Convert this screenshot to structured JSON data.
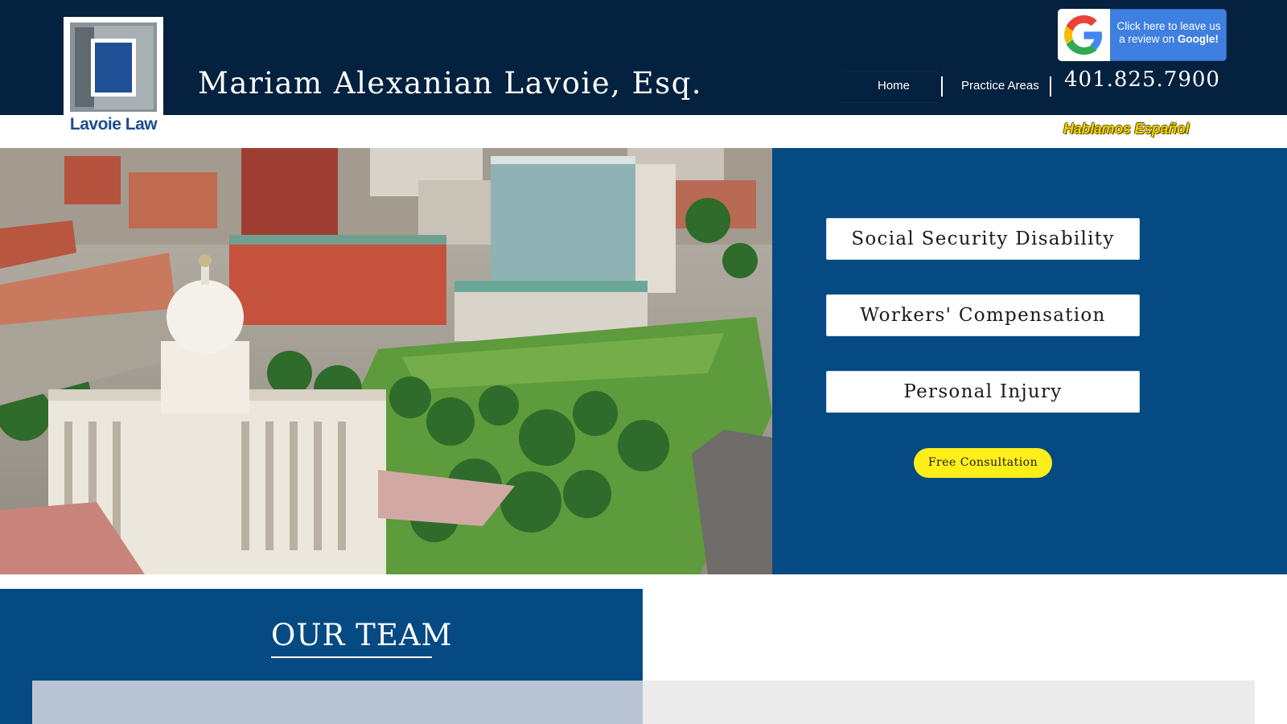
{
  "header": {
    "logo_text": "Lavoie Law",
    "firm_name": "Mariam Alexanian Lavoie, Esq.",
    "google_badge": {
      "line1": "Click here to leave us",
      "line2_prefix": "a review on ",
      "line2_bold": "Google!",
      "icon": "google-g-icon"
    },
    "nav": {
      "items": [
        {
          "label": "Home"
        },
        {
          "label": "Practice Areas"
        }
      ]
    },
    "phone": "401.825.7900",
    "spanish_tagline": "Hablamos Español"
  },
  "hero": {
    "image_description_icon": "providence-aerial-photo",
    "services": [
      {
        "label": "Social Security Disability"
      },
      {
        "label": "Workers' Compensation"
      },
      {
        "label": "Personal Injury"
      }
    ],
    "cta_label": "Free Consultation"
  },
  "team": {
    "title": "OUR TEAM"
  },
  "colors": {
    "header_bg": "#04213f",
    "panel_blue": "#064a84",
    "cta_yellow": "#ffee1a",
    "tagline_yellow": "#f2d400"
  }
}
